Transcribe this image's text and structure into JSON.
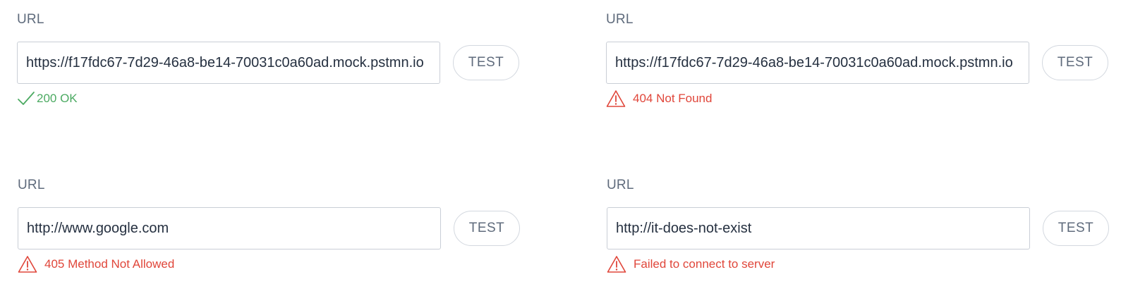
{
  "colors": {
    "label": "#5f6b7c",
    "input_text": "#253040",
    "input_border": "#c9ced6",
    "success": "#4caa62",
    "error": "#e0463a"
  },
  "panels": [
    {
      "label": "URL",
      "url_value": "https://f17fdc67-7d29-46a8-be14-70031c0a60ad.mock.pstmn.io",
      "button_label": "TEST",
      "status": {
        "kind": "success",
        "icon": "check-icon",
        "text": "200 OK"
      }
    },
    {
      "label": "URL",
      "url_value": "https://f17fdc67-7d29-46a8-be14-70031c0a60ad.mock.pstmn.io",
      "button_label": "TEST",
      "status": {
        "kind": "error",
        "icon": "warning-icon",
        "text": "404 Not Found"
      }
    },
    {
      "label": "URL",
      "url_value": "http://www.google.com",
      "button_label": "TEST",
      "status": {
        "kind": "error",
        "icon": "warning-icon",
        "text": "405 Method Not Allowed"
      }
    },
    {
      "label": "URL",
      "url_value": "http://it-does-not-exist",
      "button_label": "TEST",
      "status": {
        "kind": "error",
        "icon": "warning-icon",
        "text": "Failed to connect to server"
      }
    }
  ]
}
